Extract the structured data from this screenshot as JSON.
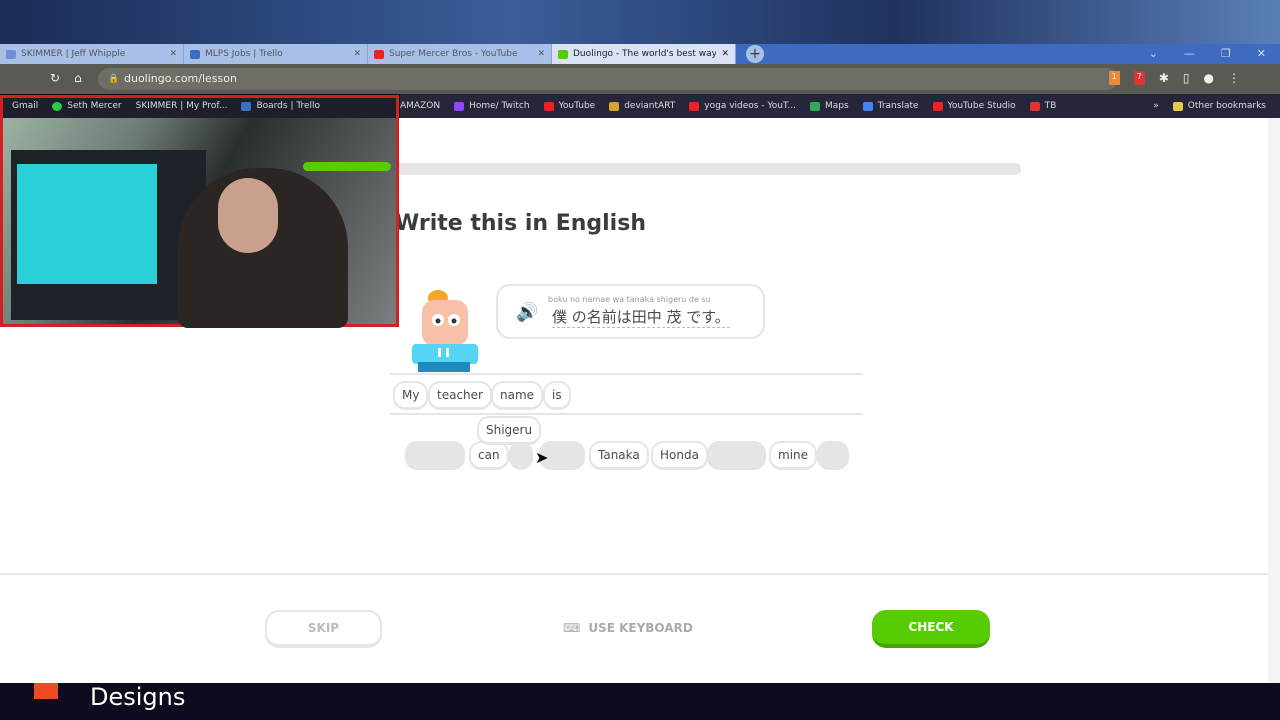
{
  "browser": {
    "tabs": [
      {
        "title": "SKIMMER | Jeff Whipple",
        "color": "#6c8fd6"
      },
      {
        "title": "MLPS Jobs | Trello",
        "color": "#3a6fc4"
      },
      {
        "title": "Super Mercer Bros - YouTube",
        "color": "#e22"
      },
      {
        "title": "Duolingo - The world's best way",
        "color": "#58cc02",
        "active": true
      }
    ],
    "url": "duolingo.com/lesson",
    "bookmarks": [
      "Gmail",
      "Seth Mercer",
      "SKIMMER | My Prof...",
      "Boards | Trello",
      "AMAZON",
      "Home/ Twitch",
      "YouTube",
      "deviantART",
      "yoga videos - YouT...",
      "Maps",
      "Translate",
      "YouTube Studio",
      "TB"
    ],
    "other_bookmarks": "Other bookmarks",
    "extension_badges": [
      "1",
      "7"
    ]
  },
  "lesson": {
    "progress": 0.0,
    "title": "Write this in English",
    "furigana": "boku no namae wa tanaka shigeru de su",
    "sentence": "僕 の名前は田中  茂  です。",
    "answer_tokens": [
      "My",
      "teacher",
      "name",
      "is"
    ],
    "dragging_token": "Shigeru",
    "bank_tokens": [
      "can",
      "Tanaka",
      "Honda",
      "mine"
    ],
    "skip": "SKIP",
    "use_keyboard": "USE KEYBOARD",
    "check": "CHECK",
    "accent": "#58cc02"
  },
  "overlay": {
    "footer_text": "Designs"
  }
}
